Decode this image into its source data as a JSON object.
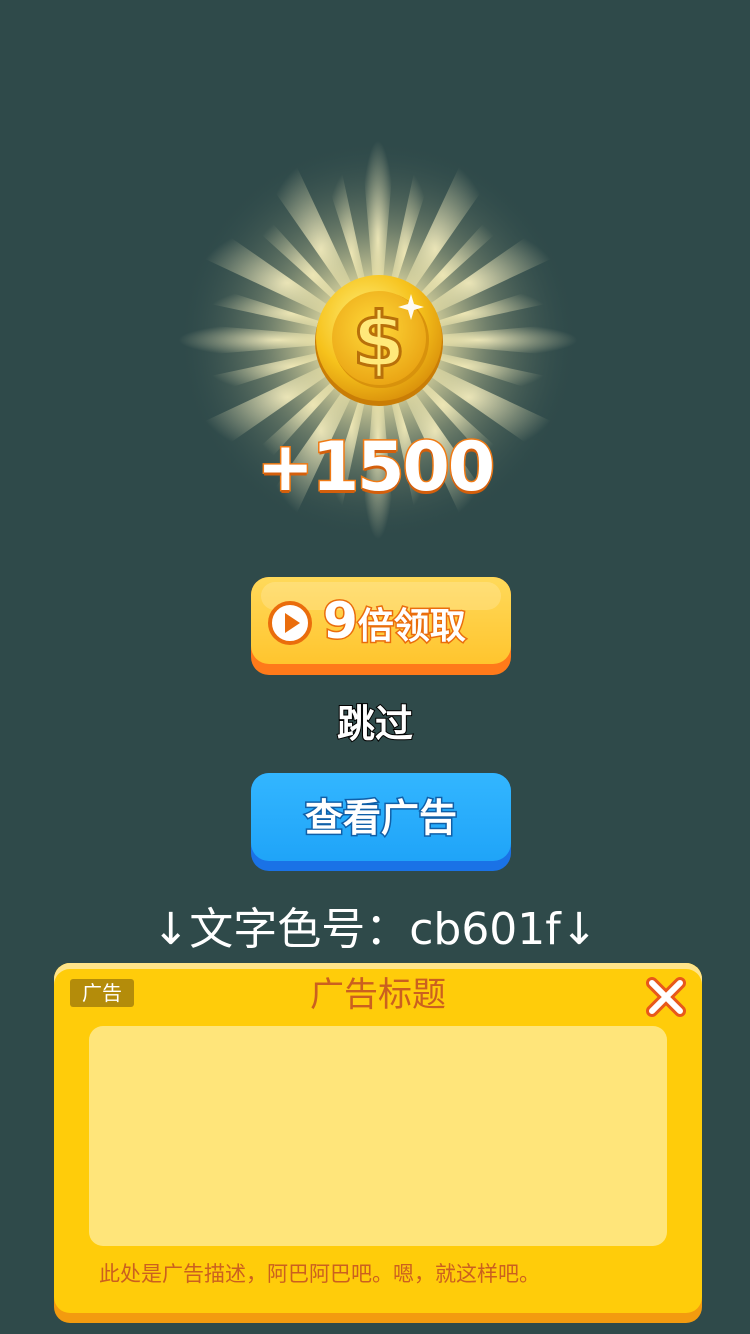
{
  "reward": {
    "amount_text": "+1500",
    "coin_icon": "dollar-coin-icon"
  },
  "claim_button": {
    "multiplier": "9",
    "label": "倍领取",
    "icon": "play-circle-icon"
  },
  "skip_label": "跳过",
  "watch_ad_button": {
    "label": "查看广告"
  },
  "color_note": "↓文字色号：cb601f↓",
  "ad_panel": {
    "tag": "广告",
    "title": "广告标题",
    "description": "此处是广告描述，阿巴阿巴吧。嗯，就这样吧。",
    "close_icon": "close-x-icon"
  },
  "colors": {
    "background": "#2f4a4a",
    "claim_button": "#ffc52e",
    "claim_button_edge": "#ff7a1a",
    "ad_button": "#1fa4f8",
    "ad_button_edge": "#1a72e6",
    "panel": "#ffcc0a",
    "panel_image": "#ffe57a",
    "ad_text": "#cb601f",
    "reward_stroke": "#f07a14"
  }
}
